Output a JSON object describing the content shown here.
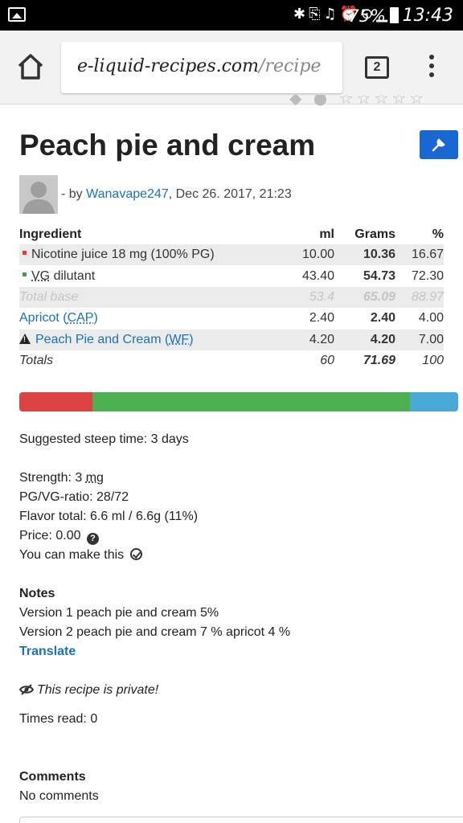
{
  "status_bar": {
    "battery_percent": "75%",
    "time": "13:43"
  },
  "browser": {
    "url_domain": "e-liquid-recipes.com",
    "url_path": "/recipe",
    "tab_count": "2"
  },
  "recipe": {
    "title": "Peach pie and cream",
    "by_prefix": "- by",
    "author": "Wanavape247",
    "date": ", Dec 26. 2017, 21:23"
  },
  "table": {
    "headers": {
      "ingredient": "Ingredient",
      "ml": "ml",
      "grams": "Grams",
      "pct": "%"
    },
    "rows": [
      {
        "name": "Nicotine juice 18 mg (100% PG)",
        "ml": "10.00",
        "grams": "10.36",
        "pct": "16.67",
        "dot_color": "#e53935"
      },
      {
        "name_prefix": "VG",
        "name_suffix": " dilutant",
        "ml": "43.40",
        "grams": "54.73",
        "pct": "72.30",
        "dot_color": "#43a047"
      },
      {
        "name": "Total base",
        "ml": "53.4",
        "grams": "65.09",
        "pct": "88.97"
      },
      {
        "name": "Apricot",
        "brand": "CAP",
        "ml": "2.40",
        "grams": "2.40",
        "pct": "4.00"
      },
      {
        "name": "Peach Pie and Cream",
        "brand": "WF",
        "ml": "4.20",
        "grams": "4.20",
        "pct": "7.00"
      },
      {
        "name": "Totals",
        "ml": "60",
        "grams": "71.69",
        "pct": "100"
      }
    ]
  },
  "ratio_bar": {
    "segments": [
      {
        "name": "nicotine",
        "fraction": 0.1667,
        "color": "#dc4343"
      },
      {
        "name": "vg",
        "fraction": 0.723,
        "color": "#4caf50"
      },
      {
        "name": "flavor",
        "fraction": 0.11,
        "color": "#4aa8d6"
      }
    ]
  },
  "details": {
    "steep": "Suggested steep time: 3 days",
    "strength_label": "Strength: 3 ",
    "strength_unit": "mg",
    "pgvg": "PG/VG-ratio: 28/72",
    "flavor_total": "Flavor total: 6.6 ml / 6.6g (11%)",
    "price": "Price: 0.00",
    "can_make": "You can make this"
  },
  "notes": {
    "heading": "Notes",
    "line1": "Version 1 peach pie and cream 5%",
    "line2": "Version 2 peach pie and cream 7 % apricot 4 %",
    "translate": "Translate"
  },
  "private_text": "This recipe is private!",
  "times_read": "Times read: 0",
  "comments": {
    "heading": "Comments",
    "empty": "No comments"
  }
}
